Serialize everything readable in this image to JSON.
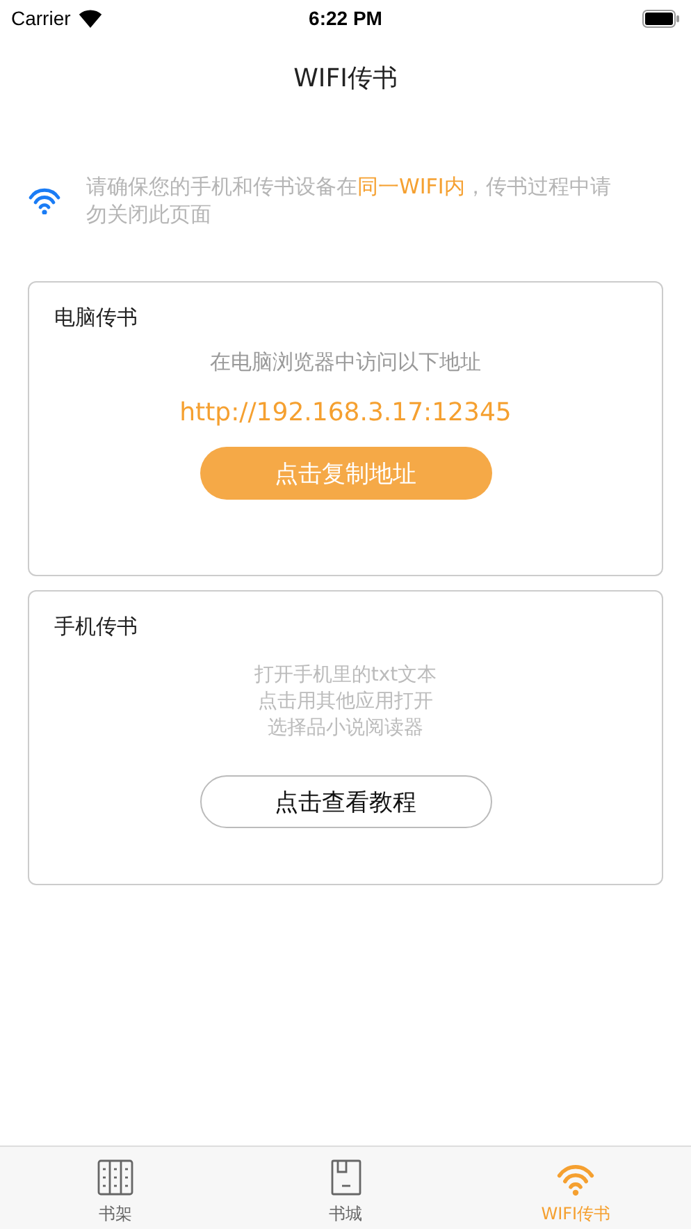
{
  "status_bar": {
    "carrier": "Carrier",
    "time": "6:22 PM"
  },
  "nav": {
    "title": "WIFI传书"
  },
  "notice": {
    "text": "请确保您的手机和传书设备在**同一WIFI内**，传书过程中请勿关闭此页面"
  },
  "cards": [
    {
      "kind": "computer",
      "title": "电脑传书",
      "lines": [
        "在电脑浏览器中访问以下地址"
      ],
      "address": "http://192.168.3.17:12345",
      "button": {
        "label": "点击复制地址",
        "kind": "filled"
      }
    },
    {
      "kind": "phone",
      "title": "手机传书",
      "lines": [
        "打开手机里的txt文本",
        "点击用其他应用打开",
        "选择品小说阅读器"
      ],
      "button": {
        "label": "点击查看教程",
        "kind": "outline"
      }
    }
  ],
  "tab_bar": [
    {
      "kind": "shelf",
      "label": "书架",
      "selected": false
    },
    {
      "kind": "store",
      "label": "书城",
      "selected": false
    },
    {
      "kind": "wifi",
      "label": "WIFI传书",
      "selected": true
    }
  ]
}
